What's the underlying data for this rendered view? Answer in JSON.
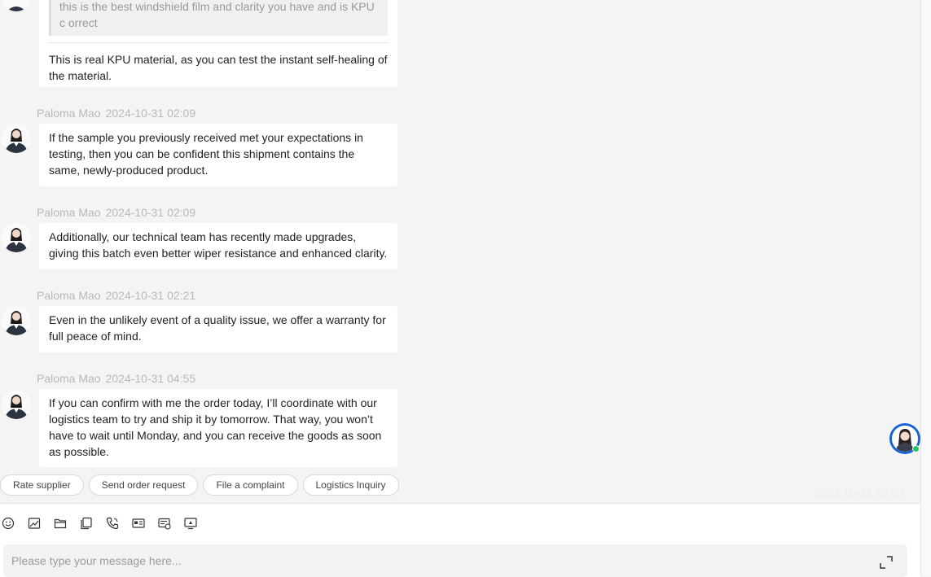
{
  "messages": [
    {
      "quote": "this is the best windshield film and clarity you have and is KPU c orrect",
      "text": "This is real KPU material, as you can test the instant self-healing of the material."
    },
    {
      "sender": "Paloma Mao",
      "time": "2024-10-31 02:09",
      "text": "If the sample you previously received met your expectations in testing, then you can be confident this shipment contains the same, newly-produced product."
    },
    {
      "sender": "Paloma Mao",
      "time": "2024-10-31 02:09",
      "text": "Additionally, our technical team has recently made upgrades, giving this batch even better wiper resistance and enhanced clarity."
    },
    {
      "sender": "Paloma Mao",
      "time": "2024-10-31 02:21",
      "text": "Even in the unlikely event of a quality issue, we offer a warranty for full peace of mind."
    },
    {
      "sender": "Paloma Mao",
      "time": "2024-10-31 04:55",
      "text": "If you can confirm with me the order today, I’ll coordinate with our logistics team to try and ship it by tomorrow. That way, you won’t have to wait until Monday, and you can receive the goods as soon as possible."
    }
  ],
  "quick_actions": [
    "Rate supplier",
    "Send order request",
    "File a complaint",
    "Logistics Inquiry"
  ],
  "ghost_timestamp": "2024-10-31 20:30",
  "toolbar_icons": [
    "emoji-icon",
    "image-icon",
    "folder-icon",
    "copy-icon",
    "phone-icon",
    "card-icon",
    "quote-sheet-icon",
    "screen-icon"
  ],
  "composer": {
    "placeholder": "Please type your message here..."
  },
  "colors": {
    "accent": "#1663d9",
    "online": "#22c55e",
    "bubble": "#ffffff",
    "background": "#f4f4f4"
  }
}
